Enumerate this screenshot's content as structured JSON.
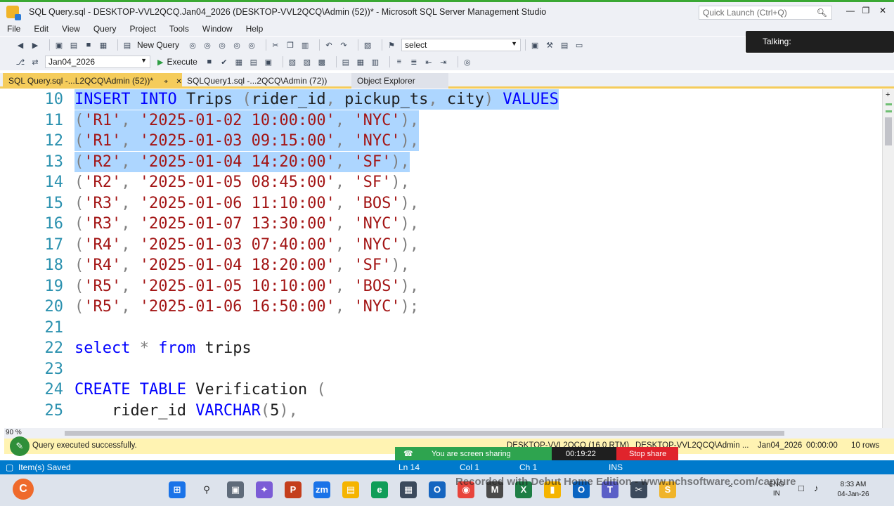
{
  "window": {
    "title": "SQL Query.sql - DESKTOP-VVL2QCQ.Jan04_2026 (DESKTOP-VVL2QCQ\\Admin (52))* - Microsoft SQL Server Management Studio",
    "quick_launch_placeholder": "Quick Launch (Ctrl+Q)"
  },
  "menu": [
    "File",
    "Edit",
    "View",
    "Query",
    "Project",
    "Tools",
    "Window",
    "Help"
  ],
  "toolbar": {
    "new_query": "New Query",
    "search_combo_value": "select",
    "database_value": "Jan04_2026",
    "execute": "Execute"
  },
  "talking_label": "Talking:",
  "tabs": {
    "active": "SQL Query.sql -...L2QCQ\\Admin (52))*",
    "second": "SQLQuery1.sql -...2QCQ\\Admin (72))",
    "object_explorer": "Object Explorer"
  },
  "editor": {
    "zoom": "90 %",
    "lines": [
      {
        "n": "10",
        "tokens": [
          [
            "kw",
            "INSERT INTO "
          ],
          [
            "t",
            "Trips "
          ],
          [
            "g",
            "("
          ],
          [
            "t",
            "rider_id"
          ],
          [
            "g",
            ", "
          ],
          [
            "t",
            "pickup_ts"
          ],
          [
            "g",
            ", "
          ],
          [
            "t",
            "city"
          ],
          [
            "g",
            ") "
          ],
          [
            "kw",
            "VALUES"
          ]
        ],
        "sel": "full"
      },
      {
        "n": "11",
        "tokens": [
          [
            "g",
            "("
          ],
          [
            "s",
            "'R1'"
          ],
          [
            "g",
            ", "
          ],
          [
            "s",
            "'2025-01-02 10:00:00'"
          ],
          [
            "g",
            ", "
          ],
          [
            "s",
            "'NYC'"
          ],
          [
            "g",
            "),"
          ]
        ],
        "sel": "full"
      },
      {
        "n": "12",
        "tokens": [
          [
            "g",
            "("
          ],
          [
            "s",
            "'R1'"
          ],
          [
            "g",
            ", "
          ],
          [
            "s",
            "'2025-01-03 09:15:00'"
          ],
          [
            "g",
            ", "
          ],
          [
            "s",
            "'NYC'"
          ],
          [
            "g",
            "),"
          ]
        ],
        "sel": "full"
      },
      {
        "n": "13",
        "tokens": [
          [
            "g",
            "("
          ],
          [
            "s",
            "'R2'"
          ],
          [
            "g",
            ", "
          ],
          [
            "s",
            "'2025-01-04 14:20:00'"
          ],
          [
            "g",
            ", "
          ],
          [
            "s",
            "'SF'"
          ],
          [
            "g",
            "),"
          ]
        ],
        "sel": "full"
      },
      {
        "n": "14",
        "tokens": [
          [
            "g",
            "("
          ],
          [
            "s",
            "'R2'"
          ],
          [
            "g",
            ", "
          ],
          [
            "s",
            "'2025-01-05 08:45:00'"
          ],
          [
            "g",
            ", "
          ],
          [
            "s",
            "'SF'"
          ],
          [
            "g",
            "),"
          ]
        ],
        "sel": "none"
      },
      {
        "n": "15",
        "tokens": [
          [
            "g",
            "("
          ],
          [
            "s",
            "'R3'"
          ],
          [
            "g",
            ", "
          ],
          [
            "s",
            "'2025-01-06 11:10:00'"
          ],
          [
            "g",
            ", "
          ],
          [
            "s",
            "'BOS'"
          ],
          [
            "g",
            "),"
          ]
        ],
        "sel": "none"
      },
      {
        "n": "16",
        "tokens": [
          [
            "g",
            "("
          ],
          [
            "s",
            "'R3'"
          ],
          [
            "g",
            ", "
          ],
          [
            "s",
            "'2025-01-07 13:30:00'"
          ],
          [
            "g",
            ", "
          ],
          [
            "s",
            "'NYC'"
          ],
          [
            "g",
            "),"
          ]
        ],
        "sel": "none"
      },
      {
        "n": "17",
        "tokens": [
          [
            "g",
            "("
          ],
          [
            "s",
            "'R4'"
          ],
          [
            "g",
            ", "
          ],
          [
            "s",
            "'2025-01-03 07:40:00'"
          ],
          [
            "g",
            ", "
          ],
          [
            "s",
            "'NYC'"
          ],
          [
            "g",
            "),"
          ]
        ],
        "sel": "none"
      },
      {
        "n": "18",
        "tokens": [
          [
            "g",
            "("
          ],
          [
            "s",
            "'R4'"
          ],
          [
            "g",
            ", "
          ],
          [
            "s",
            "'2025-01-04 18:20:00'"
          ],
          [
            "g",
            ", "
          ],
          [
            "s",
            "'SF'"
          ],
          [
            "g",
            "),"
          ]
        ],
        "sel": "none"
      },
      {
        "n": "19",
        "tokens": [
          [
            "g",
            "("
          ],
          [
            "s",
            "'R5'"
          ],
          [
            "g",
            ", "
          ],
          [
            "s",
            "'2025-01-05 10:10:00'"
          ],
          [
            "g",
            ", "
          ],
          [
            "s",
            "'BOS'"
          ],
          [
            "g",
            "),"
          ]
        ],
        "sel": "none"
      },
      {
        "n": "20",
        "tokens": [
          [
            "g",
            "("
          ],
          [
            "s",
            "'R5'"
          ],
          [
            "g",
            ", "
          ],
          [
            "s",
            "'2025-01-06 16:50:00'"
          ],
          [
            "g",
            ", "
          ],
          [
            "s",
            "'NYC'"
          ],
          [
            "g",
            ");"
          ]
        ],
        "sel": "none"
      },
      {
        "n": "21",
        "tokens": [],
        "sel": "none"
      },
      {
        "n": "22",
        "tokens": [
          [
            "kw",
            "select "
          ],
          [
            "g",
            "* "
          ],
          [
            "kw",
            "from "
          ],
          [
            "t",
            "trips"
          ]
        ],
        "sel": "none"
      },
      {
        "n": "23",
        "tokens": [],
        "sel": "none"
      },
      {
        "n": "24",
        "tokens": [
          [
            "kw",
            "CREATE TABLE "
          ],
          [
            "t",
            "Verification "
          ],
          [
            "g",
            "("
          ]
        ],
        "sel": "none"
      },
      {
        "n": "25",
        "tokens": [
          [
            "t",
            "    rider_id "
          ],
          [
            "kw",
            "VARCHAR"
          ],
          [
            "g",
            "("
          ],
          [
            "t",
            "5"
          ],
          [
            "g",
            "),"
          ]
        ],
        "sel": "none"
      }
    ]
  },
  "query_status": {
    "message": "Query executed successfully.",
    "server": "DESKTOP-VVL2QCQ (16.0 RTM)",
    "user": "DESKTOP-VVL2QCQ\\Admin ...",
    "database": "Jan04_2026",
    "elapsed": "00:00:00",
    "rows": "10 rows"
  },
  "screen_share": {
    "message": "You are screen sharing",
    "timer": "00:19:22",
    "stop": "Stop share"
  },
  "statusbar": {
    "saved": "Item(s) Saved",
    "line": "Ln 14",
    "col": "Col 1",
    "ch": "Ch 1",
    "mode": "INS"
  },
  "taskbar": {
    "watermark": "Recorded with Debut Home Edition - www.nchsoftware.com/capture",
    "lang_top": "ENG",
    "lang_bottom": "IN",
    "time": "8:33 AM",
    "date": "04-Jan-26"
  }
}
